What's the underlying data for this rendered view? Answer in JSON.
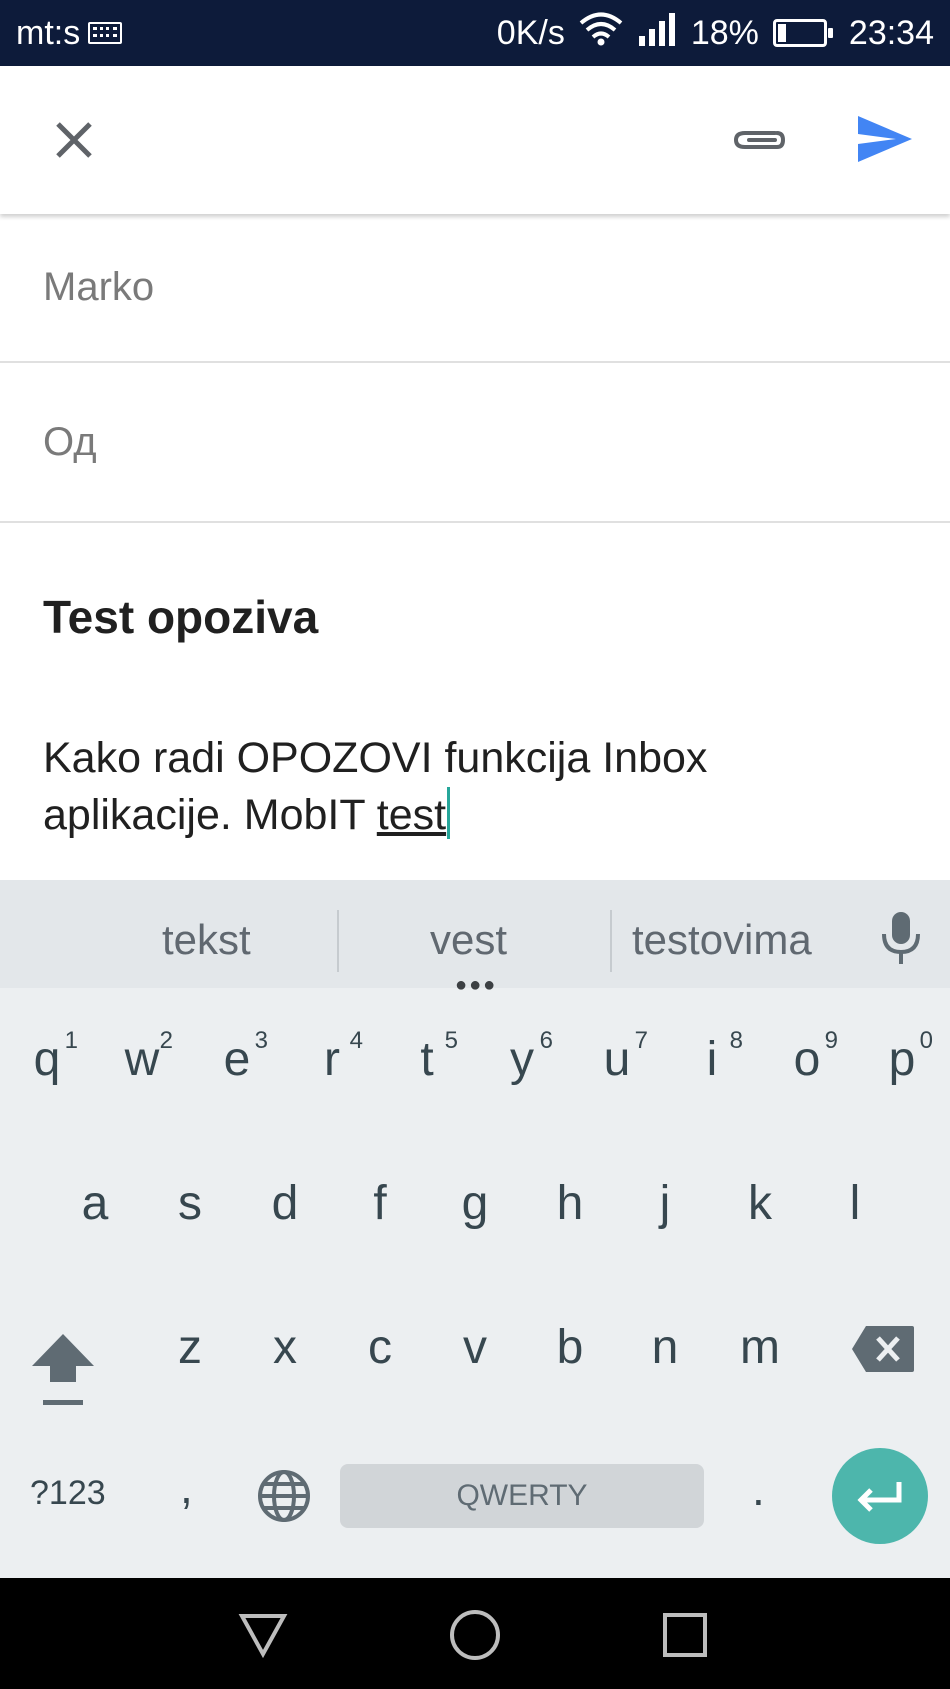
{
  "status_bar": {
    "carrier": "mt:s",
    "net_speed": "0K/s",
    "battery_percent": "18%",
    "battery_level": 0.18,
    "time": "23:34"
  },
  "toolbar": {
    "close_icon": "close-icon",
    "attach_icon": "paperclip-icon",
    "send_icon": "send-icon",
    "send_color": "#4285f4"
  },
  "compose": {
    "to_value": "Marko",
    "from_label": "Од",
    "subject": "Test opoziva",
    "body_line1": "Kako radi OPOZOVI funkcija Inbox",
    "body_line2_prefix": "aplikacije. MobIT ",
    "body_line2_word": "test"
  },
  "keyboard": {
    "suggestions": [
      "tekst",
      "vest",
      "testovima"
    ],
    "row1": [
      {
        "key": "q",
        "num": "1"
      },
      {
        "key": "w",
        "num": "2"
      },
      {
        "key": "e",
        "num": "3"
      },
      {
        "key": "r",
        "num": "4"
      },
      {
        "key": "t",
        "num": "5"
      },
      {
        "key": "y",
        "num": "6"
      },
      {
        "key": "u",
        "num": "7"
      },
      {
        "key": "i",
        "num": "8"
      },
      {
        "key": "o",
        "num": "9"
      },
      {
        "key": "p",
        "num": "0"
      }
    ],
    "row2": [
      "a",
      "s",
      "d",
      "f",
      "g",
      "h",
      "j",
      "k",
      "l"
    ],
    "row3": [
      "z",
      "x",
      "c",
      "v",
      "b",
      "n",
      "m"
    ],
    "symbols_label": "?123",
    "comma": ",",
    "space_label": "QWERTY",
    "period": ".",
    "enter_color": "#4db6ac"
  }
}
